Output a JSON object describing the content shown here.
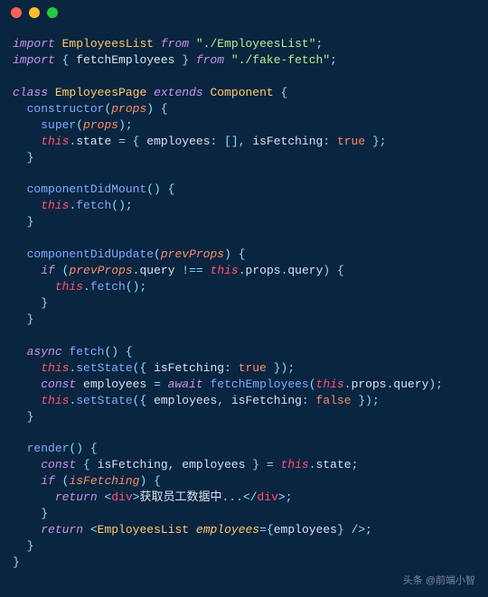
{
  "titlebar": {
    "dots": [
      "red",
      "yellow",
      "green"
    ]
  },
  "code": {
    "l1": {
      "kw1": "import",
      "cls": "EmployeesList",
      "kw2": "from",
      "str": "\"./EmployeesList\"",
      "semi": ";"
    },
    "l2": {
      "kw1": "import",
      "lb": "{ ",
      "id": "fetchEmployees",
      "rb": " }",
      "kw2": "from",
      "str": "\"./fake-fetch\"",
      "semi": ";"
    },
    "l4": {
      "kw1": "class",
      "cls1": "EmployeesPage",
      "kw2": "extends",
      "cls2": "Component",
      "lb": "{"
    },
    "l5": {
      "fn": "constructor",
      "lp": "(",
      "param": "props",
      "rp": ")",
      "lb": "{"
    },
    "l6": {
      "super": "super",
      "lp": "(",
      "param": "props",
      "rp": ");"
    },
    "l7": {
      "this": "this",
      "dot": ".",
      "prop": "state",
      "eq": " = ",
      "lb": "{ ",
      "k1": "employees",
      "c1": ": ",
      "v1": "[]",
      "cm": ", ",
      "k2": "isFetching",
      "c2": ": ",
      "v2": "true",
      "rb": " };"
    },
    "l8": {
      "rb": "}"
    },
    "l10": {
      "fn": "componentDidMount",
      "lp": "()",
      "lb": "{"
    },
    "l11": {
      "this": "this",
      "dot": ".",
      "fn": "fetch",
      "call": "();"
    },
    "l12": {
      "rb": "}"
    },
    "l14": {
      "fn": "componentDidUpdate",
      "lp": "(",
      "param": "prevProps",
      "rp": ")",
      "lb": "{"
    },
    "l15": {
      "kw": "if",
      "lp": "(",
      "p1": "prevProps",
      "d1": ".",
      "pr1": "query",
      "op": " !== ",
      "this": "this",
      "d2": ".",
      "pr2": "props",
      "d3": ".",
      "pr3": "query",
      "rp": ")",
      "lb": "{"
    },
    "l16": {
      "this": "this",
      "dot": ".",
      "fn": "fetch",
      "call": "();"
    },
    "l17": {
      "rb": "}"
    },
    "l18": {
      "rb": "}"
    },
    "l20": {
      "kw": "async",
      "fn": "fetch",
      "lp": "()",
      "lb": "{"
    },
    "l21": {
      "this": "this",
      "dot": ".",
      "fn": "setState",
      "lp": "({ ",
      "k": "isFetching",
      "c": ": ",
      "v": "true",
      "rp": " });"
    },
    "l22": {
      "kw1": "const",
      "id": "employees",
      "eq": " = ",
      "kw2": "await",
      "fn": "fetchEmployees",
      "lp": "(",
      "this": "this",
      "d1": ".",
      "pr1": "props",
      "d2": ".",
      "pr2": "query",
      "rp": ");"
    },
    "l23": {
      "this": "this",
      "dot": ".",
      "fn": "setState",
      "lp": "({ ",
      "k1": "employees",
      "cm": ", ",
      "k2": "isFetching",
      "c2": ": ",
      "v2": "false",
      "rp": " });"
    },
    "l24": {
      "rb": "}"
    },
    "l26": {
      "fn": "render",
      "lp": "()",
      "lb": "{"
    },
    "l27": {
      "kw": "const",
      "lb": "{ ",
      "id1": "isFetching",
      "cm": ", ",
      "id2": "employees",
      "rb": " }",
      "eq": " = ",
      "this": "this",
      "dot": ".",
      "prop": "state",
      "semi": ";"
    },
    "l28": {
      "kw": "if",
      "lp": "(",
      "id": "isFetching",
      "rp": ")",
      "lb": "{"
    },
    "l29": {
      "kw": "return",
      "lt": "<",
      "tag": "div",
      "gt": ">",
      "txt": "获取员工数据中",
      "dots": "...",
      "lt2": "</",
      "tag2": "div",
      "gt2": ">;"
    },
    "l30": {
      "rb": "}"
    },
    "l31": {
      "kw": "return",
      "lt": "<",
      "tag": "EmployeesList",
      "attr": "employees",
      "eq": "=",
      "lb": "{",
      "id": "employees",
      "rb": "}",
      "close": " />;"
    },
    "l32": {
      "rb": "}"
    },
    "l33": {
      "rb": "}"
    }
  },
  "watermark": "头条 @前端小智"
}
